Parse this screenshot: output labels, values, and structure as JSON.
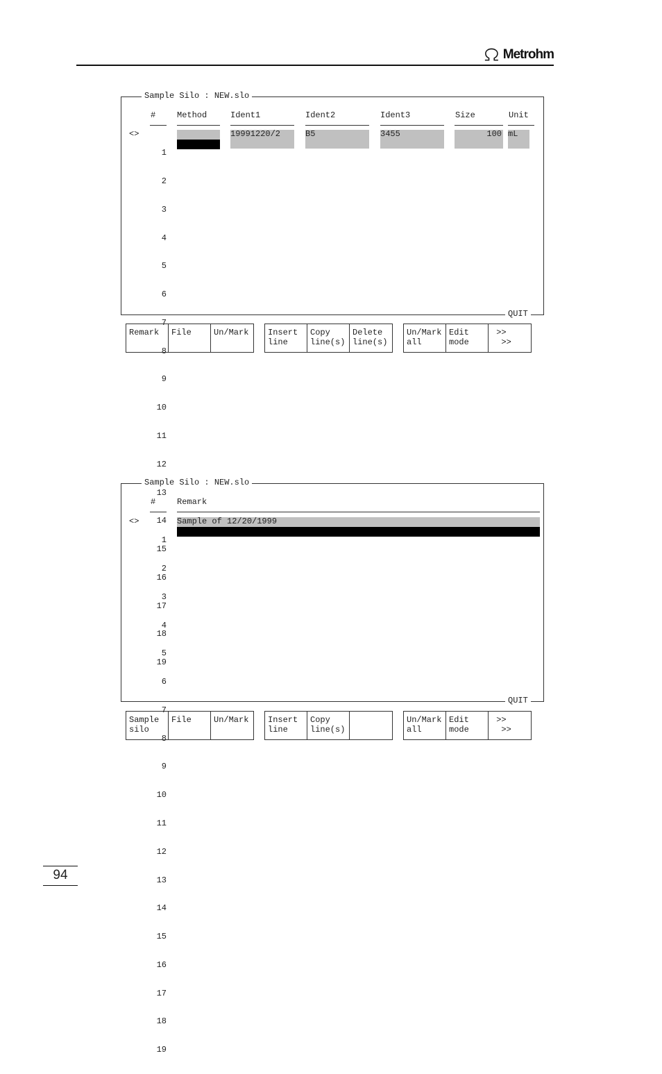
{
  "header": {
    "brand": "Metrohm",
    "logo_icon": "omega-icon"
  },
  "screen1": {
    "title": "Sample Silo : NEW.slo",
    "quit": "QUIT",
    "cursor": "<>",
    "hash": "#",
    "columns": [
      "Method",
      "Ident1",
      "Ident2",
      "Ident3",
      "Size",
      "Unit"
    ],
    "rows": [
      "1",
      "2",
      "3",
      "4",
      "5",
      "6",
      "7",
      "8",
      "9",
      "10",
      "11",
      "12",
      "13",
      "14",
      "15",
      "16",
      "17",
      "18",
      "19"
    ],
    "row1": {
      "ident1": "19991220/2",
      "ident2": "B5",
      "ident3": "3455",
      "size": "100",
      "unit": "mL"
    },
    "softkeys": {
      "group1": [
        [
          "Remark",
          ""
        ],
        [
          "File",
          ""
        ],
        [
          "Un/Mark",
          ""
        ]
      ],
      "group2": [
        [
          "Insert",
          "line"
        ],
        [
          "Copy",
          "line(s)"
        ],
        [
          "Delete",
          "line(s)"
        ]
      ],
      "group3": [
        [
          "Un/Mark",
          "all"
        ],
        [
          "Edit",
          "mode"
        ],
        [
          " >>",
          "  >>"
        ]
      ]
    }
  },
  "screen2": {
    "title": "Sample Silo : NEW.slo",
    "quit": "QUIT",
    "cursor": "<>",
    "hash": "#",
    "columns": [
      "Remark"
    ],
    "rows": [
      "1",
      "2",
      "3",
      "4",
      "5",
      "6",
      "7",
      "8",
      "9",
      "10",
      "11",
      "12",
      "13",
      "14",
      "15",
      "16",
      "17",
      "18",
      "19"
    ],
    "row1": {
      "remark": "Sample of 12/20/1999"
    },
    "softkeys": {
      "group1": [
        [
          "Sample",
          "silo"
        ],
        [
          "File",
          ""
        ],
        [
          "Un/Mark",
          ""
        ]
      ],
      "group2": [
        [
          "Insert",
          "line"
        ],
        [
          "Copy",
          "line(s)"
        ],
        [
          "",
          ""
        ]
      ],
      "group3": [
        [
          "Un/Mark",
          "all"
        ],
        [
          "Edit",
          "mode"
        ],
        [
          " >>",
          "  >>"
        ]
      ]
    }
  },
  "page_number": "94"
}
